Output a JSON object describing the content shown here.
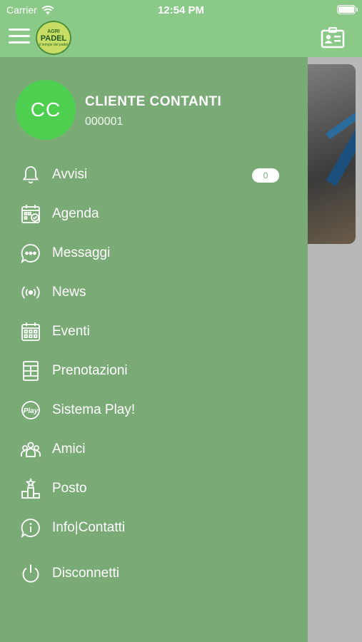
{
  "status_bar": {
    "carrier": "Carrier",
    "time": "12:54 PM"
  },
  "app_bar": {
    "logo": {
      "top": "AGRI",
      "main": "PADEL",
      "sub": "il tempio del padel"
    }
  },
  "profile": {
    "initials": "CC",
    "name": "CLIENTE CONTANTI",
    "code": "000001"
  },
  "menu": {
    "items": [
      {
        "label": "Avvisi",
        "icon": "bell-icon",
        "badge": "0"
      },
      {
        "label": "Agenda",
        "icon": "calendar-check-icon"
      },
      {
        "label": "Messaggi",
        "icon": "chat-bubble-icon"
      },
      {
        "label": "News",
        "icon": "broadcast-icon"
      },
      {
        "label": "Eventi",
        "icon": "calendar-grid-icon"
      },
      {
        "label": "Prenotazioni",
        "icon": "court-icon"
      },
      {
        "label": "Sistema Play!",
        "icon": "play-badge-icon"
      },
      {
        "label": "Amici",
        "icon": "friends-icon"
      },
      {
        "label": "Posto",
        "icon": "podium-icon"
      },
      {
        "label": "Info|Contatti",
        "icon": "info-bubble-icon"
      },
      {
        "label": "Disconnetti",
        "icon": "power-icon"
      }
    ]
  },
  "colors": {
    "header": "#8ac987",
    "drawer": "#7aab77",
    "avatar": "#4fcf4f",
    "overlay": "#b8b8b8"
  }
}
